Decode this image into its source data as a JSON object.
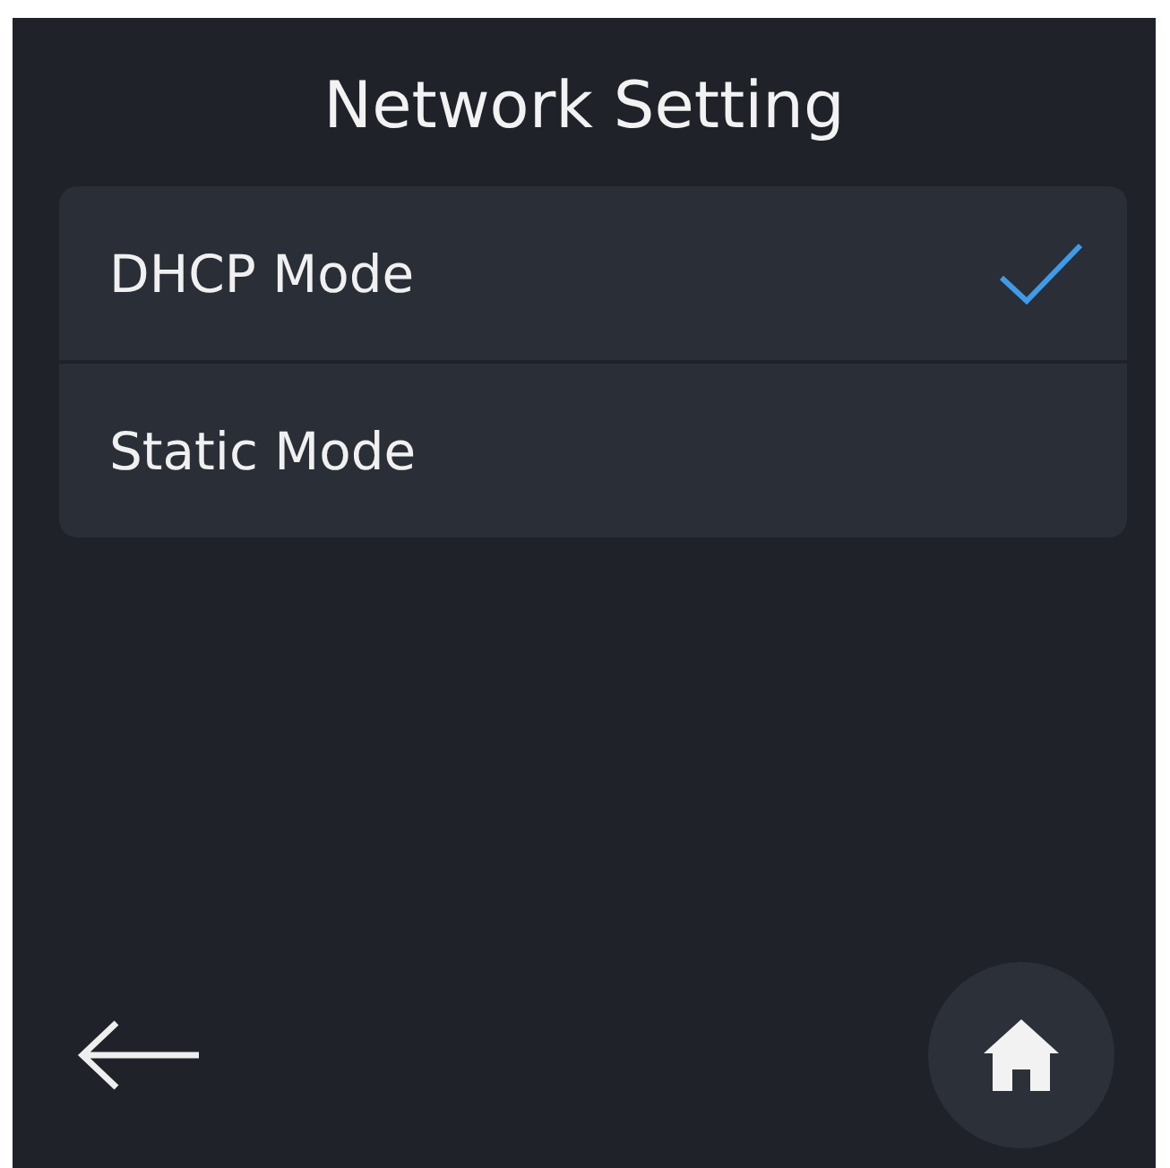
{
  "title": "Network Setting",
  "options": [
    {
      "label": "DHCP Mode",
      "selected": true
    },
    {
      "label": "Static Mode",
      "selected": false
    }
  ]
}
